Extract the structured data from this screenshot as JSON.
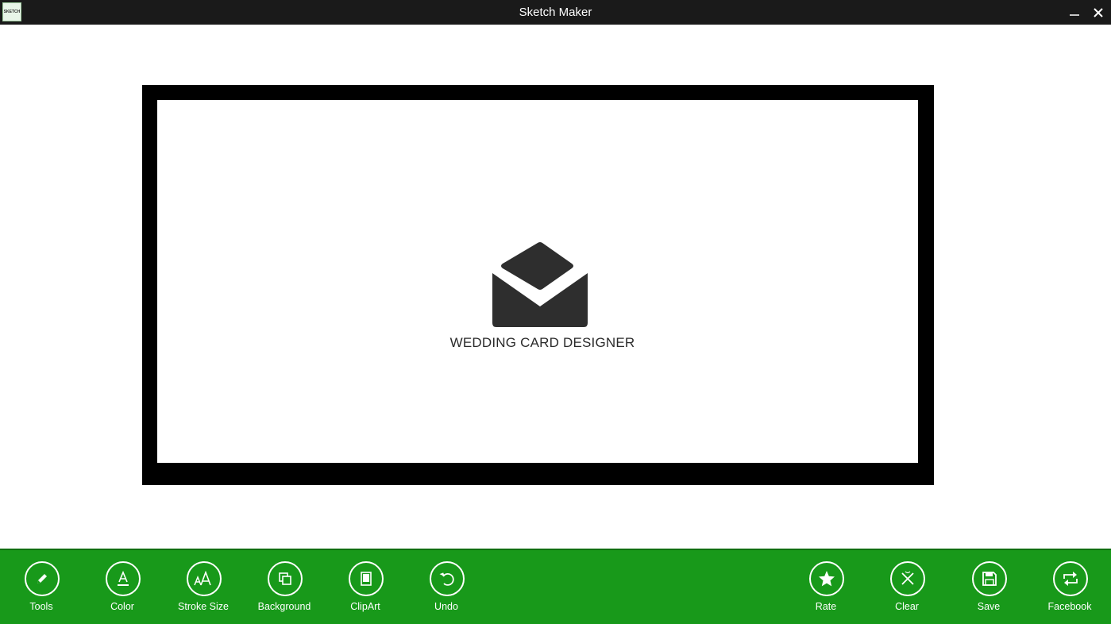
{
  "window": {
    "title": "Sketch Maker",
    "app_icon_text": "SKETCH"
  },
  "canvas": {
    "logo_text": "WEDDING CARD DESIGNER"
  },
  "colors": {
    "appbar": "#18991a",
    "titlebar": "#1a1a1a",
    "frame": "#000000"
  },
  "appbar": {
    "left": [
      {
        "label": "Tools",
        "icon": "pencil-icon"
      },
      {
        "label": "Color",
        "icon": "font-color-icon"
      },
      {
        "label": "Stroke Size",
        "icon": "font-size-icon"
      },
      {
        "label": "Background",
        "icon": "layers-icon"
      },
      {
        "label": "ClipArt",
        "icon": "tablet-icon"
      },
      {
        "label": "Undo",
        "icon": "undo-icon"
      }
    ],
    "right": [
      {
        "label": "Rate",
        "icon": "star-icon"
      },
      {
        "label": "Clear",
        "icon": "clear-icon"
      },
      {
        "label": "Save",
        "icon": "save-icon"
      },
      {
        "label": "Facebook",
        "icon": "share-icon"
      }
    ]
  }
}
